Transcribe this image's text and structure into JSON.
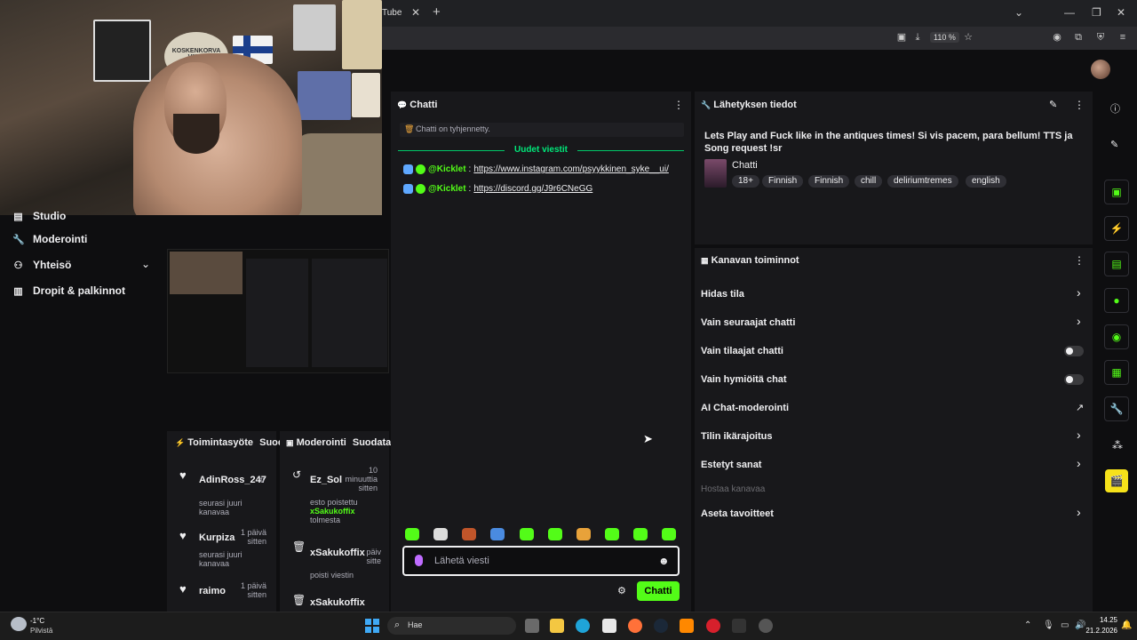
{
  "browser": {
    "tab_title": "Tube",
    "tab_close": "✕",
    "tab_new": "+",
    "zoom": "110 %"
  },
  "webcam": {
    "poster_text": "KOSKENKORVA VIINA"
  },
  "nav": {
    "items": [
      {
        "label": "Studio",
        "icon": "studio-icon"
      },
      {
        "label": "Moderointi",
        "icon": "wrench-icon"
      },
      {
        "label": "Yhteisö",
        "icon": "community-icon"
      },
      {
        "label": "Dropit & palkinnot",
        "icon": "gift-icon"
      }
    ]
  },
  "activity": {
    "title": "Toimintasyöte",
    "filter": "Suoc",
    "items": [
      {
        "name": "AdinRoss_247",
        "time": "ti",
        "desc": "seurasi juuri kanavaa"
      },
      {
        "name": "Kurpiza",
        "time": "1 päivä sitten",
        "desc": "seurasi juuri kanavaa"
      },
      {
        "name": "raimo",
        "time": "1 päivä sitten",
        "desc": ""
      }
    ]
  },
  "moderation": {
    "title": "Moderointi",
    "filter": "Suodata",
    "items": [
      {
        "name": "Ez_Sol",
        "time": "10 minuuttia sitten",
        "desc_prefix": "esto poistettu",
        "desc_user": "xSakukoffix",
        "desc_suffix": "tolmesta"
      },
      {
        "name": "xSakukoffix",
        "time": "päiv sitte",
        "desc_prefix": "poisti viestin",
        "desc_user": "",
        "desc_suffix": ""
      },
      {
        "name": "xSakukoffix",
        "time": "",
        "desc_prefix": "",
        "desc_user": "",
        "desc_suffix": ""
      }
    ]
  },
  "chat": {
    "title": "Chatti",
    "cleared": "Chatti on tyhjennetty.",
    "new_messages": "Uudet viestit",
    "messages": [
      {
        "user": "@Kicklet",
        "sep": ":",
        "text": "https://www.instagram.com/psyykkinen_syke__ui/"
      },
      {
        "user": "@Kicklet",
        "sep": ":",
        "text": "https://discord.gg/J9r6CNeGG"
      }
    ],
    "input_placeholder": "Lähetä viesti",
    "send_button": "Chatti"
  },
  "stream_info": {
    "title": "Lähetyksen tiedot",
    "stream_title": "Lets Play and Fuck like in the antiques times! Si vis pacem, para bellum! TTS ja Song request !sr",
    "category": "Chatti",
    "tags": [
      "18+",
      "Finnish",
      "Finnish",
      "chill",
      "deliriumtremes",
      "english"
    ]
  },
  "channel_actions": {
    "title": "Kanavan toiminnot",
    "items": [
      {
        "label": "Hidas tila",
        "control": "chevron"
      },
      {
        "label": "Vain seuraajat chatti",
        "control": "chevron"
      },
      {
        "label": "Vain tilaajat chatti",
        "control": "toggle"
      },
      {
        "label": "Vain hymiöitä chat",
        "control": "toggle"
      },
      {
        "label": "AI Chat-moderointi",
        "control": "external"
      },
      {
        "label": "Tilin ikärajoitus",
        "control": "chevron"
      },
      {
        "label": "Estetyt sanat",
        "control": "chevron"
      },
      {
        "label": "Hostaa kanavaa",
        "control": "none"
      },
      {
        "label": "Aseta tavoitteet",
        "control": "chevron"
      }
    ]
  },
  "taskbar": {
    "weather_temp": "-1°C",
    "weather_desc": "Pilvistä",
    "search": "Hae",
    "time": "14.25",
    "date": "21.2.2026"
  },
  "colors": {
    "accent": "#53fc18",
    "background": "#0e0e10",
    "panel": "#18181b"
  }
}
